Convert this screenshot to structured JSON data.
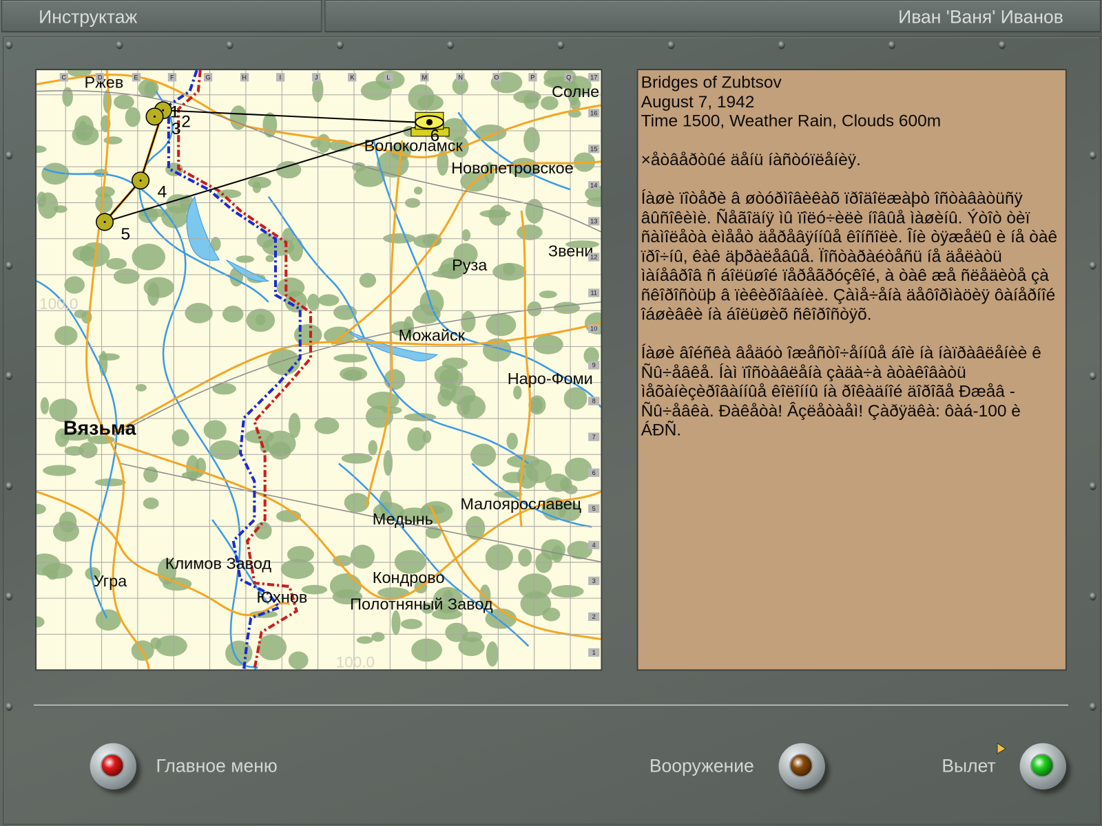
{
  "header": {
    "title": "Инструктаж",
    "pilot_name": "Иван 'Ваня' Иванов"
  },
  "map": {
    "column_labels": [
      "C",
      "D",
      "E",
      "F",
      "G",
      "H",
      "I",
      "J",
      "K",
      "L",
      "M",
      "N",
      "O",
      "P",
      "Q"
    ],
    "row_labels": [
      "17",
      "16",
      "15",
      "14",
      "13",
      "12",
      "11",
      "10",
      "9",
      "8",
      "7",
      "6",
      "5",
      "4",
      "3",
      "2",
      "1"
    ],
    "cities": [
      "Ржев",
      "Солне",
      "Волоколамск",
      "Новопетровское",
      "Звени",
      "Руза",
      "Можайск",
      "Наро-Фоми",
      "Вязьма",
      "Малоярославец",
      "Медынь",
      "Климов Завод",
      "Угра",
      "Кондрово",
      "Юхнов",
      "Полотняный Завод"
    ],
    "grid_values": [
      "100.0",
      "100.0"
    ],
    "waypoints": [
      "1",
      "2",
      "3",
      "4",
      "5",
      "6"
    ],
    "target_icon": "eye-target-icon",
    "colors": {
      "background": "#fdfbe0",
      "forest": "#8fb07a",
      "river": "#3a9ae8",
      "road": "#f5a623",
      "front_red": "#c81e1e",
      "front_blue": "#1e2ad0",
      "waypoint": "#b8b020"
    }
  },
  "briefing": {
    "title": "Bridges of Zubtsov",
    "date": "August 7, 1942",
    "conditions": "Time 1500, Weather Rain, Clouds 600m",
    "paragraph1": "×åòâåðòûé äåíü íàñòóïëåíèÿ.",
    "paragraph2": "Íàøè ïîòåðè â øòóðìîâèêàõ ïðîäîëæàþò îñòàâàòüñÿ âûñîêèìè. Ñåãîäíÿ ìû ïîëó÷èëè íîâûå ìàøèíû. Ýòîò òèï ñàìîëåòà èìååò äåðåâÿííûå êîíñîëè. Îíè òÿæåëû è íå òàê ïðî÷íû, êàê äþðàëåâûå. Ïîñòàðàéòåñü íå äåëàòü ìàíåâðîâ ñ áîëüøîé ïåðåãðóçêîé, à òàê æå ñëåäèòå çà ñêîðîñòüþ â ïèêèðîâàíèè. Çàìå÷åíà äåôîðìàöèÿ ôàíåðíîé îáøèâêè íà áîëüøèõ ñêîðîñòÿõ.",
    "paragraph3": "Íàøè âîéñêà âåäóò îæåñòî÷åííûå áîè íà íàïðàâëåíèè ê Ñû÷åâêå. Íàì ïîñòàâëåíà çàäà÷à àòàêîâàòü ìåõàíèçèðîâàííûå êîëîííû íà ðîêàäíîé äîðîãå Ðæåâ - Ñû÷åâêà. Ðàêåòà! Âçëåòàåì! Çàðÿäêà: ôàá-100 è ÁÐÑ."
  },
  "footer": {
    "main_menu": {
      "label": "Главное меню",
      "lamp_color": "#e01818"
    },
    "loadout": {
      "label": "Вооружение",
      "lamp_color": "#8a4a08"
    },
    "fly": {
      "label": "Вылет",
      "lamp_color": "#1fd21f"
    }
  }
}
